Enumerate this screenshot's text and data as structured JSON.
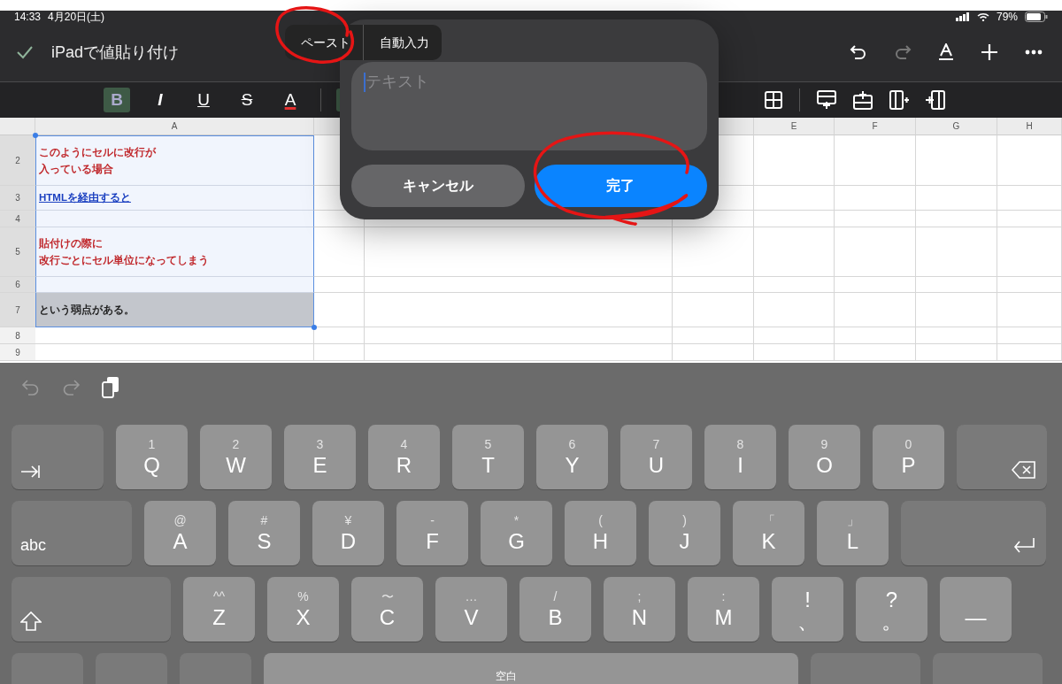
{
  "status_bar": {
    "time": "14:33",
    "date": "4月20日(土)",
    "battery": "79%"
  },
  "title_bar": {
    "title": "iPadで値貼り付け"
  },
  "format_toolbar": [
    {
      "label": "B",
      "kind": "bold",
      "selected": true
    },
    {
      "label": "I",
      "kind": "italic",
      "selected": false
    },
    {
      "label": "U",
      "kind": "underline",
      "selected": false
    },
    {
      "label": "S",
      "kind": "strike",
      "selected": false
    },
    {
      "label": "A",
      "kind": "color",
      "selected": false
    }
  ],
  "sheet": {
    "columns": [
      "A",
      "E",
      "F",
      "G",
      "H"
    ],
    "rows": [
      {
        "number": "2",
        "kind": "warning",
        "lines": [
          "このようにセルに改行が",
          "入っている場合"
        ],
        "selected": true,
        "active": false
      },
      {
        "number": "3",
        "kind": "link",
        "lines": [
          "HTMLを経由すると"
        ],
        "selected": true,
        "active": false
      },
      {
        "number": "4",
        "selected": true,
        "active": false
      },
      {
        "number": "5",
        "kind": "warning",
        "lines": [
          "貼付けの際に",
          "改行ごとにセル単位になってしまう"
        ],
        "selected": true,
        "active": false
      },
      {
        "number": "6",
        "selected": true,
        "active": false
      },
      {
        "number": "7",
        "kind": "normal",
        "lines": [
          "という弱点がある。"
        ],
        "selected": true,
        "active": true
      },
      {
        "number": "8",
        "selected": false,
        "active": false
      },
      {
        "number": "9",
        "selected": false,
        "active": false
      }
    ]
  },
  "edit_menu": [
    "ペースト",
    "自動入力"
  ],
  "dialog": {
    "placeholder": "テキスト",
    "cancel": "キャンセル",
    "done": "完了"
  },
  "keyboard": {
    "rows": [
      [
        {
          "kind": "tab"
        },
        {
          "kind": "letter",
          "main": "Q",
          "sub": "1"
        },
        {
          "kind": "letter",
          "main": "W",
          "sub": "2"
        },
        {
          "kind": "letter",
          "main": "E",
          "sub": "3"
        },
        {
          "kind": "letter",
          "main": "R",
          "sub": "4"
        },
        {
          "kind": "letter",
          "main": "T",
          "sub": "5"
        },
        {
          "kind": "letter",
          "main": "Y",
          "sub": "6"
        },
        {
          "kind": "letter",
          "main": "U",
          "sub": "7"
        },
        {
          "kind": "letter",
          "main": "I",
          "sub": "8"
        },
        {
          "kind": "letter",
          "main": "O",
          "sub": "9"
        },
        {
          "kind": "letter",
          "main": "P",
          "sub": "0"
        },
        {
          "kind": "delete"
        }
      ],
      [
        {
          "kind": "abc",
          "main": "abc"
        },
        {
          "kind": "letter",
          "main": "A",
          "sub": "@"
        },
        {
          "kind": "letter",
          "main": "S",
          "sub": "#"
        },
        {
          "kind": "letter",
          "main": "D",
          "sub": "¥"
        },
        {
          "kind": "letter",
          "main": "F",
          "sub": "-"
        },
        {
          "kind": "letter",
          "main": "G",
          "sub": "*"
        },
        {
          "kind": "letter",
          "main": "H",
          "sub": "("
        },
        {
          "kind": "letter",
          "main": "J",
          "sub": ")"
        },
        {
          "kind": "letter",
          "main": "K",
          "sub": "「"
        },
        {
          "kind": "letter",
          "main": "L",
          "sub": "」"
        },
        {
          "kind": "return"
        }
      ],
      [
        {
          "kind": "shift"
        },
        {
          "kind": "letter",
          "main": "Z",
          "sub": "^^"
        },
        {
          "kind": "letter",
          "main": "X",
          "sub": "%"
        },
        {
          "kind": "letter",
          "main": "C",
          "sub": "〜"
        },
        {
          "kind": "letter",
          "main": "V",
          "sub": "…"
        },
        {
          "kind": "letter",
          "main": "B",
          "sub": "/"
        },
        {
          "kind": "letter",
          "main": "N",
          "sub": ";"
        },
        {
          "kind": "letter",
          "main": "M",
          "sub": ":"
        },
        {
          "kind": "punct",
          "main": "、",
          "sub": "!"
        },
        {
          "kind": "punct",
          "main": "。",
          "sub": "?"
        },
        {
          "kind": "letter",
          "main": "—"
        }
      ],
      [
        {
          "kind": "blank"
        },
        {
          "kind": "blank"
        },
        {
          "kind": "blank"
        },
        {
          "kind": "space",
          "main": "空白"
        },
        {
          "kind": "wide"
        },
        {
          "kind": "wide"
        }
      ]
    ]
  }
}
